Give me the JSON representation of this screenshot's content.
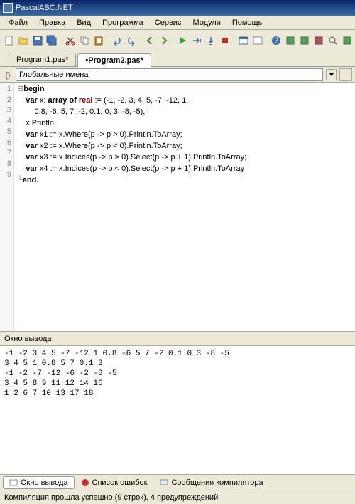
{
  "title": "PascalABC.NET",
  "menu": {
    "file": "Файл",
    "edit": "Правка",
    "view": "Вид",
    "program": "Программа",
    "service": "Сервис",
    "modules": "Модули",
    "help": "Помощь"
  },
  "tabs": {
    "t1": "Program1.pas*",
    "t2": "•Program2.pas*"
  },
  "navCombo": "Глобальные имена",
  "gutter": [
    "1",
    "2",
    "3",
    "4",
    "5",
    "6",
    "7",
    "8",
    "9"
  ],
  "code": {
    "l1a": "begin",
    "l2a": "    ",
    "l2b": "var",
    "l2c": " x: ",
    "l2d": "array of",
    "l2e": " ",
    "l2f": "real",
    "l2g": " := (-1, -2, 3, 4, 5, -7, -12, 1,",
    "l3": "        0.8, -6, 5, 7, -2, 0.1, 0, 3, -8, -5);",
    "l4": "    x.Println;",
    "l5a": "    ",
    "l5b": "var",
    "l5c": " x1 := x.Where(p -> p > 0).Println.ToArray;",
    "l6a": "    ",
    "l6b": "var",
    "l6c": " x2 := x.Where(p -> p < 0).Println.ToArray;",
    "l7a": "    ",
    "l7b": "var",
    "l7c": " x3 := x.Indices(p -> p > 0).Select(p -> p + 1).Println.ToArray;",
    "l8a": "    ",
    "l8b": "var",
    "l8c": " x4 := x.Indices(p -> p < 0).Select(p -> p + 1).Println.ToArray",
    "l9": "end."
  },
  "outputHdr": "Окно вывода",
  "output": "-1 -2 3 4 5 -7 -12 1 0.8 -6 5 7 -2 0.1 0 3 -8 -5\n3 4 5 1 0.8 5 7 0.1 3\n-1 -2 -7 -12 -6 -2 -8 -5\n3 4 5 8 9 11 12 14 16\n1 2 6 7 10 13 17 18",
  "btabs": {
    "out": "Окно вывода",
    "err": "Список ошибок",
    "msg": "Сообщения компилятора"
  },
  "status": "Компиляция прошла успешно (9 строк), 4 предупреждений"
}
